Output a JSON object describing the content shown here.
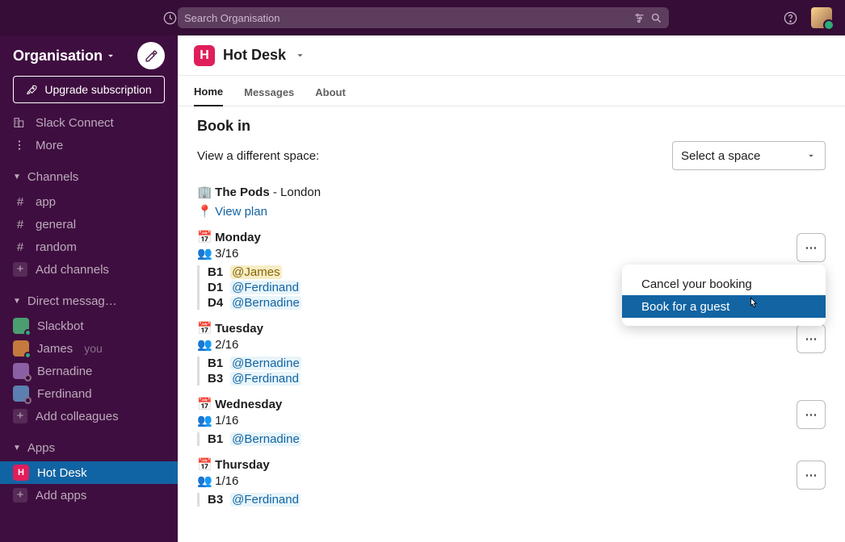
{
  "topbar": {
    "search_placeholder": "Search Organisation"
  },
  "sidebar": {
    "org_name": "Organisation",
    "upgrade_label": "Upgrade subscription",
    "quick": {
      "slack_connect": "Slack Connect",
      "more": "More"
    },
    "channels_header": "Channels",
    "channels": [
      "app",
      "general",
      "random"
    ],
    "add_channels": "Add channels",
    "dm_header": "Direct messag…",
    "dms": [
      {
        "name": "Slackbot",
        "you": false
      },
      {
        "name": "James",
        "you": true
      },
      {
        "name": "Bernadine",
        "you": false
      },
      {
        "name": "Ferdinand",
        "you": false
      }
    ],
    "you_label": "you",
    "add_colleagues": "Add colleagues",
    "apps_header": "Apps",
    "apps": [
      "Hot Desk"
    ],
    "add_apps": "Add apps"
  },
  "header": {
    "app_name": "Hot Desk"
  },
  "tabs": {
    "home": "Home",
    "messages": "Messages",
    "about": "About"
  },
  "book": {
    "title": "Book in",
    "view_space_label": "View a different space:",
    "select_placeholder": "Select a space",
    "space": {
      "name": "The Pods",
      "location": "London",
      "view_plan": "View plan"
    },
    "days": [
      {
        "name": "Monday",
        "count": "3/16",
        "bookings": [
          {
            "slot": "B1",
            "user": "@James",
            "self": true
          },
          {
            "slot": "D1",
            "user": "@Ferdinand",
            "self": false
          },
          {
            "slot": "D4",
            "user": "@Bernadine",
            "self": false
          }
        ],
        "popup": {
          "cancel": "Cancel your booking",
          "guest": "Book for a guest"
        }
      },
      {
        "name": "Tuesday",
        "count": "2/16",
        "bookings": [
          {
            "slot": "B1",
            "user": "@Bernadine",
            "self": false
          },
          {
            "slot": "B3",
            "user": "@Ferdinand",
            "self": false
          }
        ]
      },
      {
        "name": "Wednesday",
        "count": "1/16",
        "bookings": [
          {
            "slot": "B1",
            "user": "@Bernadine",
            "self": false
          }
        ]
      },
      {
        "name": "Thursday",
        "count": "1/16",
        "bookings": [
          {
            "slot": "B3",
            "user": "@Ferdinand",
            "self": false
          }
        ]
      }
    ]
  }
}
